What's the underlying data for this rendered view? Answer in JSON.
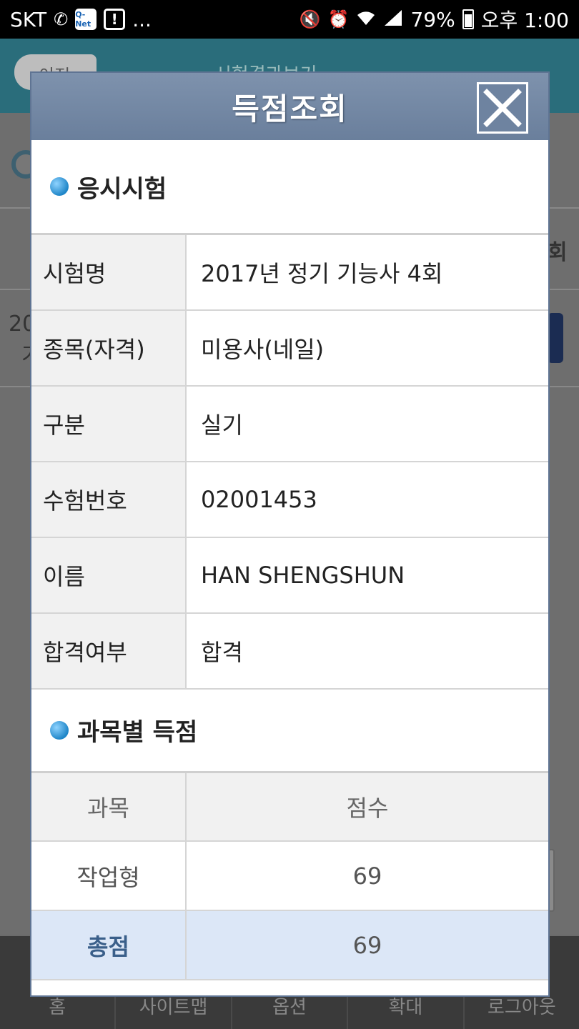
{
  "status_bar": {
    "carrier": "SKT",
    "qnet_icon_text": "Q-Net",
    "more": "...",
    "battery": "79%",
    "time": "오후 1:00"
  },
  "background": {
    "back_button": "이전",
    "page_title": "시험결과보기",
    "right_header": "회",
    "left_cell_1": "20",
    "left_cell_2": "기",
    "bottom_nav": [
      "홈",
      "사이트맵",
      "옵션",
      "확대",
      "로그아웃"
    ]
  },
  "modal": {
    "title": "득점조회",
    "section1_title": "응시시험",
    "info_rows": [
      {
        "label": "시험명",
        "value": "2017년 정기 기능사 4회"
      },
      {
        "label": "종목(자격)",
        "value": "미용사(네일)"
      },
      {
        "label": "구분",
        "value": "실기"
      },
      {
        "label": "수험번호",
        "value": "02001453"
      },
      {
        "label": "이름",
        "value": "HAN SHENGSHUN"
      },
      {
        "label": "합격여부",
        "value": "합격"
      }
    ],
    "section2_title": "과목별 득점",
    "score_headers": {
      "subject": "과목",
      "score": "점수"
    },
    "score_rows": [
      {
        "subject": "작업형",
        "score": "69"
      }
    ],
    "total": {
      "label": "총점",
      "score": "69"
    }
  },
  "colors": {
    "modal_header": "#6f84a1",
    "accent_blue": "#1f86c8",
    "total_row_bg": "#dce7f7"
  }
}
